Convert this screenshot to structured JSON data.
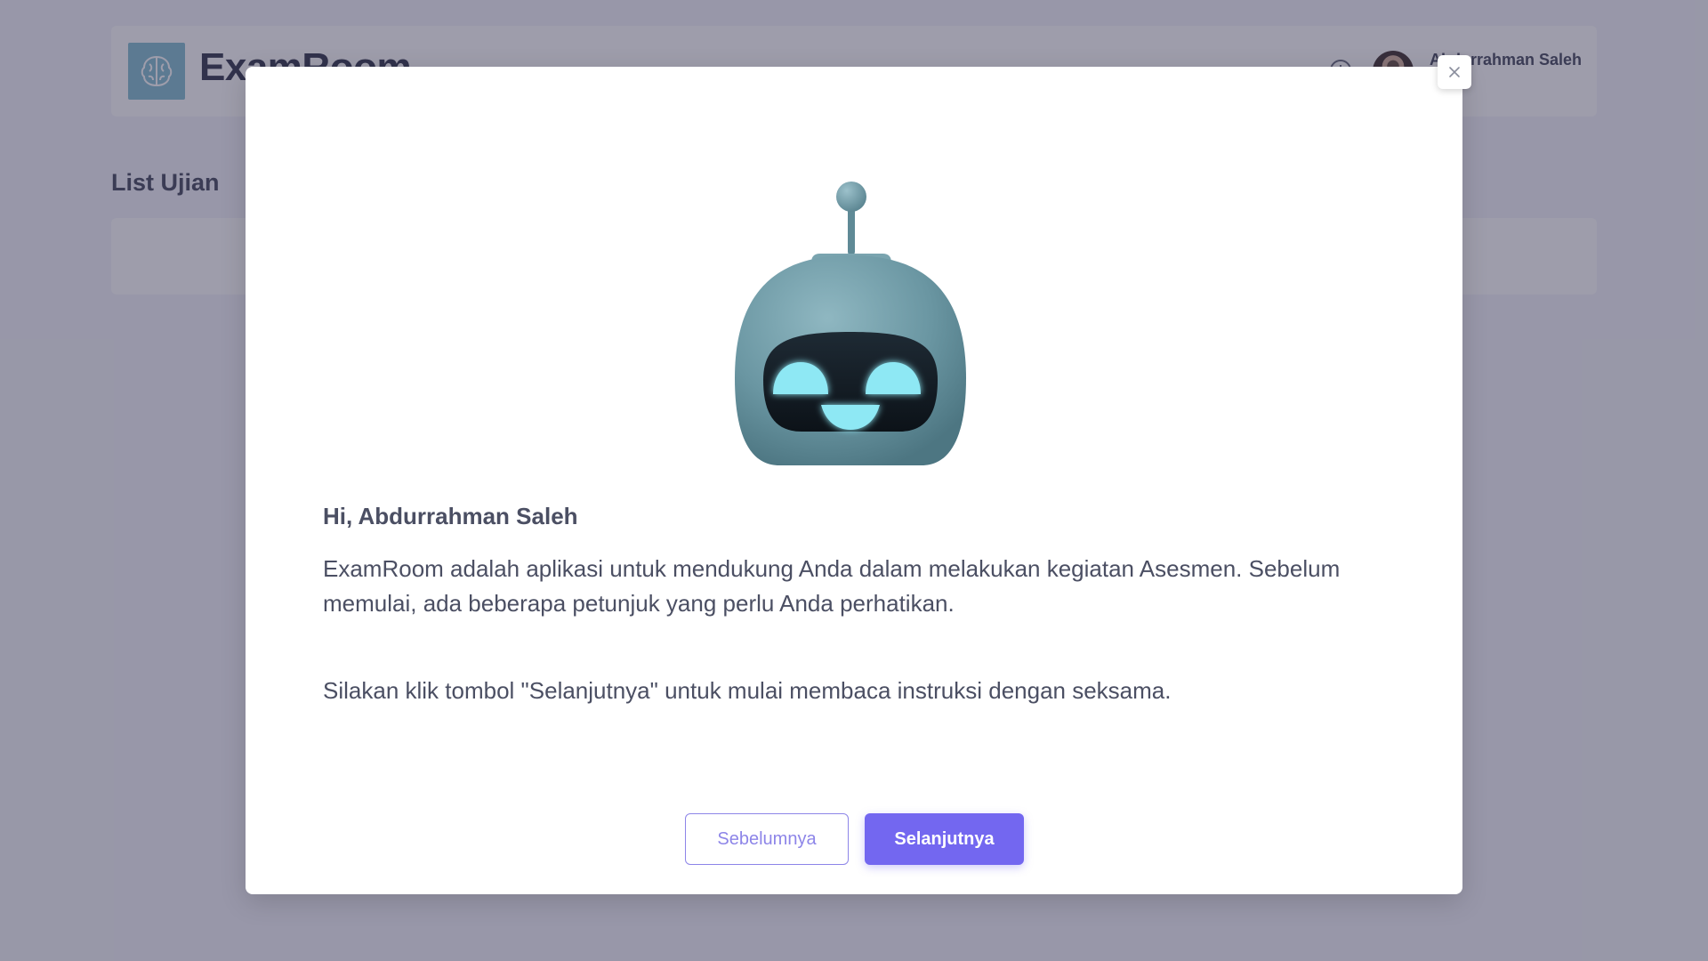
{
  "app": {
    "name": "ExamRoom",
    "username": "Abdurrahman Saleh",
    "logo_icon": "brain-icon",
    "clock_icon": "clock-icon"
  },
  "page": {
    "section_title": "List Ujian"
  },
  "modal": {
    "close_icon": "close-icon",
    "close_label": "×",
    "illustration": "robot-icon",
    "greeting": "Hi, Abdurrahman Saleh",
    "intro": "ExamRoom adalah aplikasi untuk mendukung Anda dalam melakukan kegiatan Asesmen. Sebelum memulai, ada beberapa petunjuk yang perlu Anda perhatikan.",
    "instruction": "Silakan klik tombol \"Selanjutnya\" untuk mulai membaca instruksi dengan seksama.",
    "prev_label": "Sebelumnya",
    "next_label": "Selanjutnya"
  },
  "colors": {
    "primary": "#7367f0",
    "logo_bg": "#87c0d2",
    "robot_body": "#6e9aa6",
    "robot_glow": "#8ee8f4"
  }
}
